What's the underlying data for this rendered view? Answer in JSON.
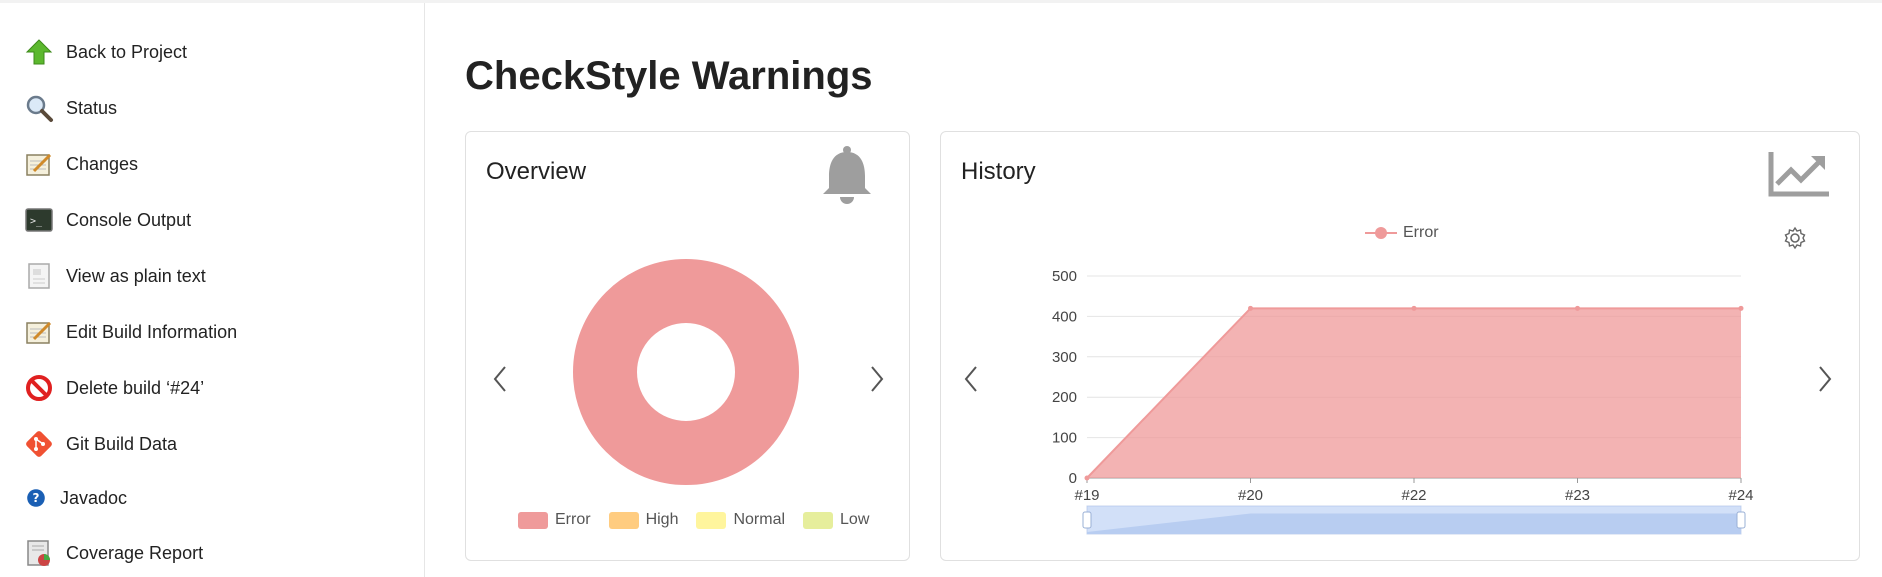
{
  "sidebar": {
    "items": [
      {
        "label": "Back to Project",
        "icon": "up-arrow-icon"
      },
      {
        "label": "Status",
        "icon": "magnifier-icon"
      },
      {
        "label": "Changes",
        "icon": "notepad-icon"
      },
      {
        "label": "Console Output",
        "icon": "terminal-icon"
      },
      {
        "label": "View as plain text",
        "icon": "document-icon"
      },
      {
        "label": "Edit Build Information",
        "icon": "notepad-icon"
      },
      {
        "label": "Delete build ‘#24’",
        "icon": "no-entry-icon"
      },
      {
        "label": "Git Build Data",
        "icon": "git-icon"
      },
      {
        "label": "Javadoc",
        "icon": "help-icon"
      },
      {
        "label": "Coverage Report",
        "icon": "coverage-icon"
      }
    ]
  },
  "page": {
    "title": "CheckStyle Warnings"
  },
  "overview": {
    "title": "Overview",
    "legend": [
      {
        "label": "Error",
        "color": "#ef9a9a"
      },
      {
        "label": "High",
        "color": "#ffcc80"
      },
      {
        "label": "Normal",
        "color": "#fff59d"
      },
      {
        "label": "Low",
        "color": "#e6ee9c"
      }
    ]
  },
  "history": {
    "title": "History",
    "legend_label": "Error"
  },
  "chart_data": [
    {
      "type": "pie",
      "categories": [
        "Error",
        "High",
        "Normal",
        "Low"
      ],
      "values": [
        420,
        0,
        0,
        0
      ],
      "colors": [
        "#ef9a9a",
        "#ffcc80",
        "#fff59d",
        "#e6ee9c"
      ],
      "legend": "bottom"
    },
    {
      "type": "area",
      "categories": [
        "#19",
        "#20",
        "#22",
        "#23",
        "#24"
      ],
      "series": [
        {
          "name": "Error",
          "values": [
            0,
            420,
            420,
            420,
            420
          ]
        }
      ],
      "ylim": [
        0,
        500
      ],
      "yticks": [
        0,
        100,
        200,
        300,
        400,
        500
      ],
      "grid": true,
      "legend": "top-center",
      "color": "#ef9a9a"
    }
  ]
}
